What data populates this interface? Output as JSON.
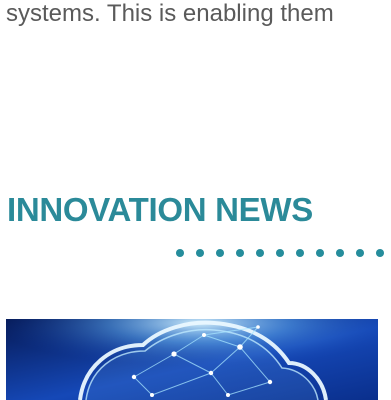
{
  "article": {
    "body_text": "systems. This is enabling them"
  },
  "section": {
    "heading": "INNOVATION NEWS",
    "accent_color": "#2b8a99",
    "divider_color": "#268d9c"
  },
  "hero_image": {
    "icon": "cloud-network-icon",
    "colors": {
      "background_dark": "#061a57",
      "background_mid": "#1548b7",
      "glow": "#d9f5ff"
    }
  }
}
